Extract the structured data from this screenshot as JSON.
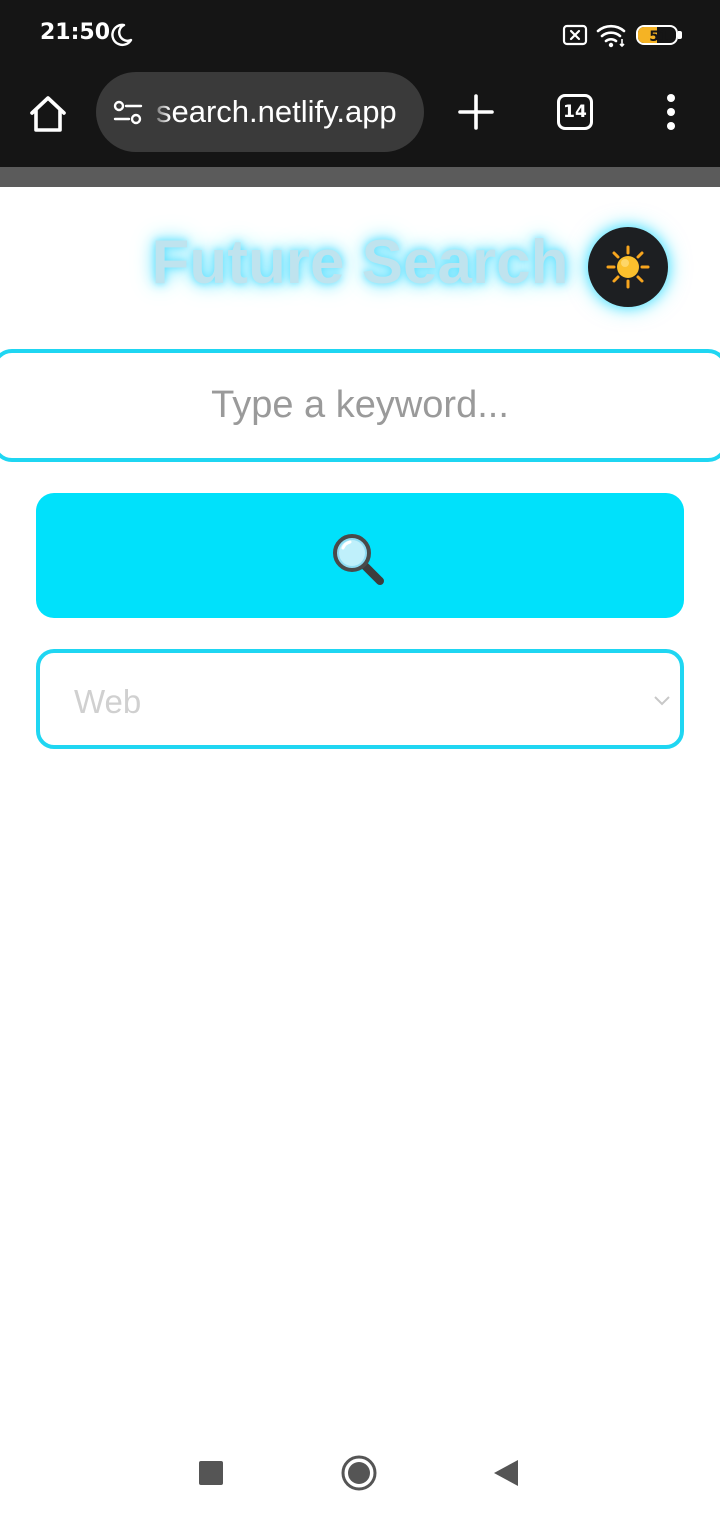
{
  "status_bar": {
    "time": "21:50",
    "icons": [
      "moon-icon",
      "sim-off-icon",
      "wifi-icon",
      "battery-icon"
    ],
    "battery_level": "51",
    "battery_fraction": 0.51,
    "battery_color": "#f5b324"
  },
  "browser": {
    "url": "search.netlify.app",
    "tab_count": "14",
    "icons": [
      "home-icon",
      "site-settings-icon",
      "plus-icon",
      "tabs-icon",
      "more-vert-icon"
    ]
  },
  "page": {
    "title": "Future Search",
    "theme_toggle_icon": "sun-icon",
    "search": {
      "placeholder": "Type a keyword...",
      "value": ""
    },
    "search_button_icon": "magnifier-icon",
    "search_type": {
      "selected": "Web"
    },
    "colors": {
      "accent": "#00e1fb",
      "border": "#1fd6f2",
      "title": "#bfe3ee"
    }
  },
  "nav_bar": {
    "icons": [
      "recents-icon",
      "home-circle-icon",
      "back-triangle-icon"
    ]
  }
}
